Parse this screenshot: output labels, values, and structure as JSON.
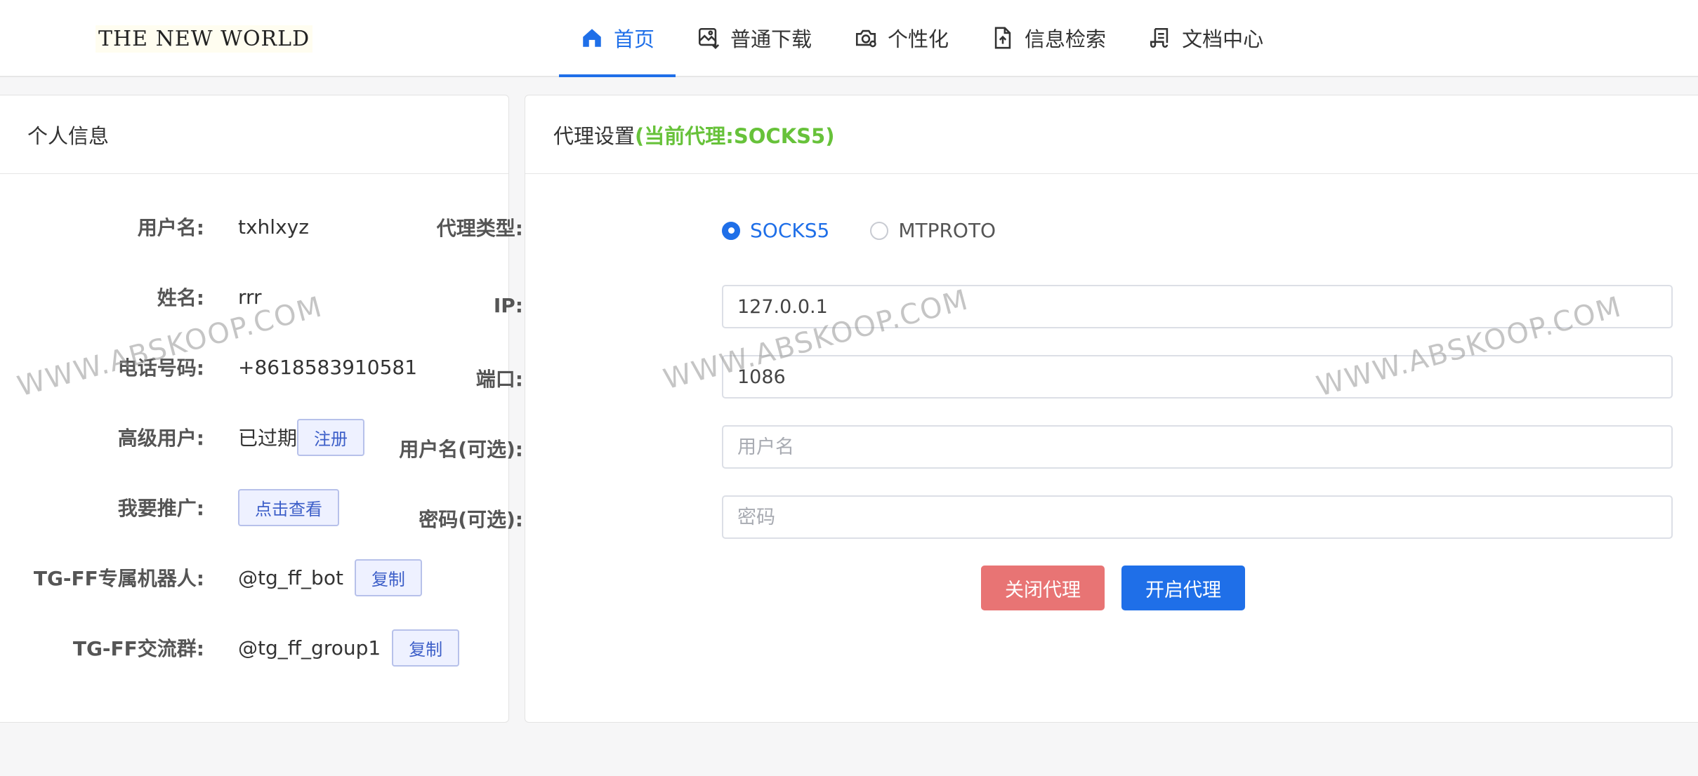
{
  "brand": "THE NEW WORLD",
  "nav": [
    {
      "label": "首页",
      "icon": "home-icon",
      "active": true
    },
    {
      "label": "普通下载",
      "icon": "image-download-icon",
      "active": false
    },
    {
      "label": "个性化",
      "icon": "camera-settings-icon",
      "active": false
    },
    {
      "label": "信息检索",
      "icon": "document-upload-icon",
      "active": false
    },
    {
      "label": "文档中心",
      "icon": "scroll-document-icon",
      "active": false
    }
  ],
  "personal": {
    "title": "个人信息",
    "rows": [
      {
        "label": "用户名:",
        "value": "txhlxyz"
      },
      {
        "label": "姓名:",
        "value": "rrr"
      },
      {
        "label": "电话号码:",
        "value": "+8618583910581"
      },
      {
        "label": "高级用户:",
        "value": "已过期",
        "button": "注册"
      },
      {
        "label": "我要推广:",
        "value": "",
        "button": "点击查看"
      },
      {
        "label": "TG-FF专属机器人:",
        "value": "@tg_ff_bot",
        "button": "复制"
      },
      {
        "label": "TG-FF交流群:",
        "value": "@tg_ff_group1",
        "button": "复制"
      }
    ]
  },
  "proxy": {
    "title": "代理设置",
    "current": "(当前代理:SOCKS5)",
    "type_label": "代理类型:",
    "options": [
      {
        "label": "SOCKS5",
        "checked": true
      },
      {
        "label": "MTPROTO",
        "checked": false
      }
    ],
    "fields": {
      "ip_label": "IP:",
      "ip_value": "127.0.0.1",
      "port_label": "端口:",
      "port_value": "1086",
      "username_label": "用户名(可选):",
      "username_placeholder": "用户名",
      "password_label": "密码(可选):",
      "password_placeholder": "密码"
    },
    "close_button": "关闭代理",
    "open_button": "开启代理"
  },
  "watermark": "WWW.ABSKOOP.COM",
  "colors": {
    "accent": "#1f6fe8",
    "highlight": "#67c23a",
    "danger": "#e87474"
  }
}
